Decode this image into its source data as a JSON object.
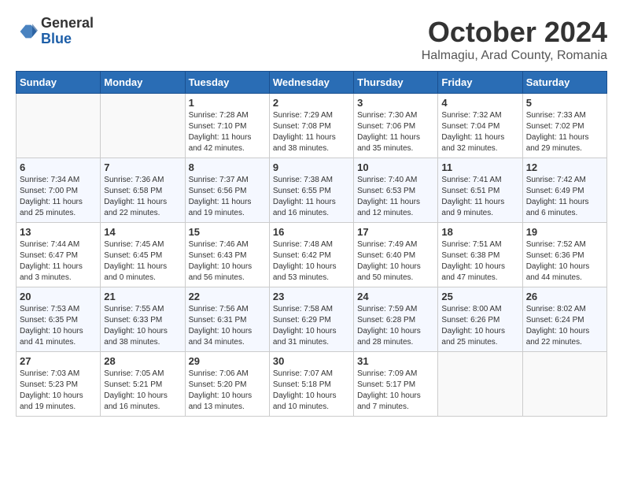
{
  "header": {
    "logo_general": "General",
    "logo_blue": "Blue",
    "month_title": "October 2024",
    "location": "Halmagiu, Arad County, Romania"
  },
  "days_of_week": [
    "Sunday",
    "Monday",
    "Tuesday",
    "Wednesday",
    "Thursday",
    "Friday",
    "Saturday"
  ],
  "weeks": [
    [
      {
        "day": "",
        "info": ""
      },
      {
        "day": "",
        "info": ""
      },
      {
        "day": "1",
        "info": "Sunrise: 7:28 AM\nSunset: 7:10 PM\nDaylight: 11 hours and 42 minutes."
      },
      {
        "day": "2",
        "info": "Sunrise: 7:29 AM\nSunset: 7:08 PM\nDaylight: 11 hours and 38 minutes."
      },
      {
        "day": "3",
        "info": "Sunrise: 7:30 AM\nSunset: 7:06 PM\nDaylight: 11 hours and 35 minutes."
      },
      {
        "day": "4",
        "info": "Sunrise: 7:32 AM\nSunset: 7:04 PM\nDaylight: 11 hours and 32 minutes."
      },
      {
        "day": "5",
        "info": "Sunrise: 7:33 AM\nSunset: 7:02 PM\nDaylight: 11 hours and 29 minutes."
      }
    ],
    [
      {
        "day": "6",
        "info": "Sunrise: 7:34 AM\nSunset: 7:00 PM\nDaylight: 11 hours and 25 minutes."
      },
      {
        "day": "7",
        "info": "Sunrise: 7:36 AM\nSunset: 6:58 PM\nDaylight: 11 hours and 22 minutes."
      },
      {
        "day": "8",
        "info": "Sunrise: 7:37 AM\nSunset: 6:56 PM\nDaylight: 11 hours and 19 minutes."
      },
      {
        "day": "9",
        "info": "Sunrise: 7:38 AM\nSunset: 6:55 PM\nDaylight: 11 hours and 16 minutes."
      },
      {
        "day": "10",
        "info": "Sunrise: 7:40 AM\nSunset: 6:53 PM\nDaylight: 11 hours and 12 minutes."
      },
      {
        "day": "11",
        "info": "Sunrise: 7:41 AM\nSunset: 6:51 PM\nDaylight: 11 hours and 9 minutes."
      },
      {
        "day": "12",
        "info": "Sunrise: 7:42 AM\nSunset: 6:49 PM\nDaylight: 11 hours and 6 minutes."
      }
    ],
    [
      {
        "day": "13",
        "info": "Sunrise: 7:44 AM\nSunset: 6:47 PM\nDaylight: 11 hours and 3 minutes."
      },
      {
        "day": "14",
        "info": "Sunrise: 7:45 AM\nSunset: 6:45 PM\nDaylight: 11 hours and 0 minutes."
      },
      {
        "day": "15",
        "info": "Sunrise: 7:46 AM\nSunset: 6:43 PM\nDaylight: 10 hours and 56 minutes."
      },
      {
        "day": "16",
        "info": "Sunrise: 7:48 AM\nSunset: 6:42 PM\nDaylight: 10 hours and 53 minutes."
      },
      {
        "day": "17",
        "info": "Sunrise: 7:49 AM\nSunset: 6:40 PM\nDaylight: 10 hours and 50 minutes."
      },
      {
        "day": "18",
        "info": "Sunrise: 7:51 AM\nSunset: 6:38 PM\nDaylight: 10 hours and 47 minutes."
      },
      {
        "day": "19",
        "info": "Sunrise: 7:52 AM\nSunset: 6:36 PM\nDaylight: 10 hours and 44 minutes."
      }
    ],
    [
      {
        "day": "20",
        "info": "Sunrise: 7:53 AM\nSunset: 6:35 PM\nDaylight: 10 hours and 41 minutes."
      },
      {
        "day": "21",
        "info": "Sunrise: 7:55 AM\nSunset: 6:33 PM\nDaylight: 10 hours and 38 minutes."
      },
      {
        "day": "22",
        "info": "Sunrise: 7:56 AM\nSunset: 6:31 PM\nDaylight: 10 hours and 34 minutes."
      },
      {
        "day": "23",
        "info": "Sunrise: 7:58 AM\nSunset: 6:29 PM\nDaylight: 10 hours and 31 minutes."
      },
      {
        "day": "24",
        "info": "Sunrise: 7:59 AM\nSunset: 6:28 PM\nDaylight: 10 hours and 28 minutes."
      },
      {
        "day": "25",
        "info": "Sunrise: 8:00 AM\nSunset: 6:26 PM\nDaylight: 10 hours and 25 minutes."
      },
      {
        "day": "26",
        "info": "Sunrise: 8:02 AM\nSunset: 6:24 PM\nDaylight: 10 hours and 22 minutes."
      }
    ],
    [
      {
        "day": "27",
        "info": "Sunrise: 7:03 AM\nSunset: 5:23 PM\nDaylight: 10 hours and 19 minutes."
      },
      {
        "day": "28",
        "info": "Sunrise: 7:05 AM\nSunset: 5:21 PM\nDaylight: 10 hours and 16 minutes."
      },
      {
        "day": "29",
        "info": "Sunrise: 7:06 AM\nSunset: 5:20 PM\nDaylight: 10 hours and 13 minutes."
      },
      {
        "day": "30",
        "info": "Sunrise: 7:07 AM\nSunset: 5:18 PM\nDaylight: 10 hours and 10 minutes."
      },
      {
        "day": "31",
        "info": "Sunrise: 7:09 AM\nSunset: 5:17 PM\nDaylight: 10 hours and 7 minutes."
      },
      {
        "day": "",
        "info": ""
      },
      {
        "day": "",
        "info": ""
      }
    ]
  ]
}
